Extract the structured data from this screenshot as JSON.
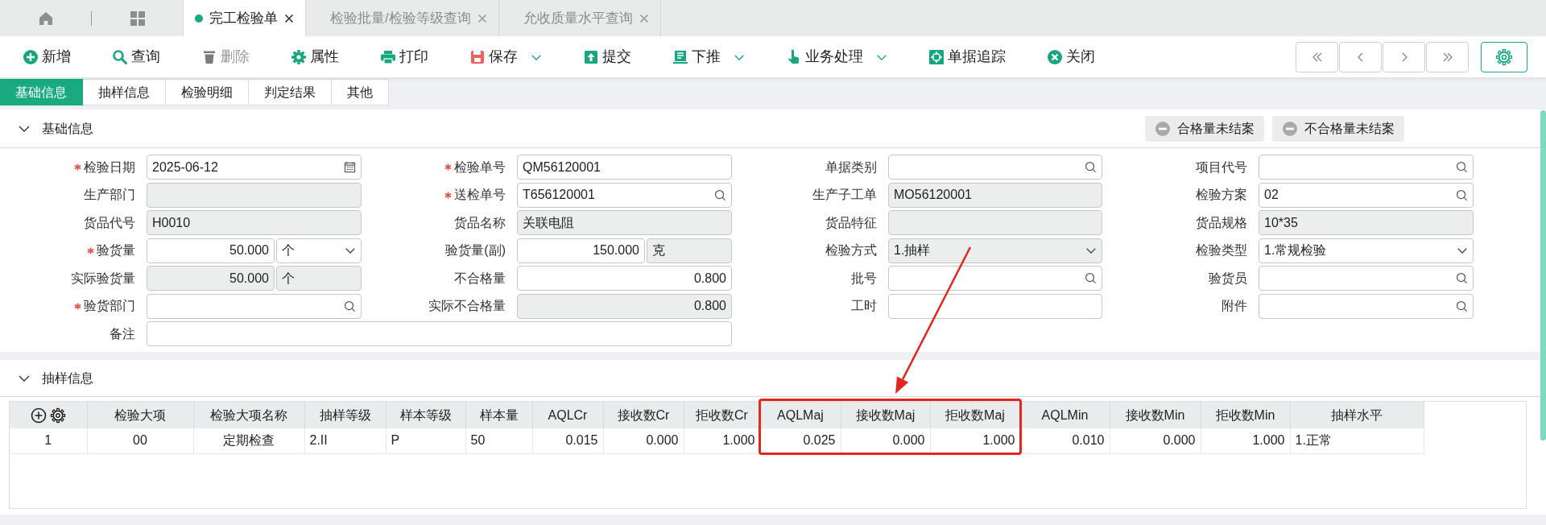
{
  "tabs": [
    {
      "label": "完工检验单",
      "selected": true
    },
    {
      "label": "检验批量/检验等级查询",
      "selected": false
    },
    {
      "label": "允收质量水平查询",
      "selected": false
    }
  ],
  "toolbar": [
    {
      "label": "新增",
      "disabled": false,
      "dropdown": false
    },
    {
      "label": "查询",
      "disabled": false,
      "dropdown": false
    },
    {
      "label": "删除",
      "disabled": true,
      "dropdown": false
    },
    {
      "label": "属性",
      "disabled": false,
      "dropdown": false
    },
    {
      "label": "打印",
      "disabled": false,
      "dropdown": false
    },
    {
      "label": "保存",
      "disabled": false,
      "dropdown": true
    },
    {
      "label": "提交",
      "disabled": false,
      "dropdown": false
    },
    {
      "label": "下推",
      "disabled": false,
      "dropdown": true
    },
    {
      "label": "业务处理",
      "disabled": false,
      "dropdown": true
    },
    {
      "label": "单据追踪",
      "disabled": false,
      "dropdown": false
    },
    {
      "label": "关闭",
      "disabled": false,
      "dropdown": false
    }
  ],
  "subtabs": [
    {
      "label": "基础信息",
      "selected": true
    },
    {
      "label": "抽样信息",
      "selected": false
    },
    {
      "label": "检验明细",
      "selected": false
    },
    {
      "label": "判定结果",
      "selected": false
    },
    {
      "label": "其他",
      "selected": false
    }
  ],
  "basic_section": {
    "title": "基础信息",
    "expanded": true,
    "actions": [
      "合格量未结案",
      "不合格量未结案"
    ],
    "rows": [
      [
        {
          "label": "检验日期",
          "required": true,
          "kind": "date",
          "readonly": false,
          "value": "2025-06-12"
        },
        {
          "label": "检验单号",
          "required": true,
          "kind": "text",
          "readonly": false,
          "value": "QM56120001"
        },
        {
          "label": "单据类别",
          "required": false,
          "kind": "lookup",
          "readonly": false
        },
        {
          "label": "项目代号",
          "required": false,
          "kind": "lookup",
          "readonly": false
        }
      ],
      [
        {
          "label": "生产部门",
          "required": false,
          "kind": "text",
          "readonly": true
        },
        {
          "label": "送检单号",
          "required": true,
          "kind": "lookup",
          "readonly": false,
          "value": "T656120001"
        },
        {
          "label": "生产子工单",
          "required": false,
          "kind": "text",
          "readonly": true,
          "value": "MO56120001"
        },
        {
          "label": "检验方案",
          "required": false,
          "kind": "lookup",
          "readonly": false,
          "value": "02"
        }
      ],
      [
        {
          "label": "货品代号",
          "required": false,
          "kind": "text",
          "readonly": true,
          "value": "H0010"
        },
        {
          "label": "货品名称",
          "required": false,
          "kind": "text",
          "readonly": true,
          "value": "关联电阻"
        },
        {
          "label": "货品特征",
          "required": false,
          "kind": "text",
          "readonly": true
        },
        {
          "label": "货品规格",
          "required": false,
          "kind": "text",
          "readonly": true,
          "value": "10*35"
        }
      ],
      [
        {
          "label": "验货量",
          "required": true,
          "kind": "quantity",
          "readonly": false,
          "value": "50.000",
          "unit": {
            "value": "个",
            "readonly": false,
            "dropdown": true
          }
        },
        {
          "label": "验货量(副)",
          "required": false,
          "kind": "quantity",
          "readonly": false,
          "value": "150.000",
          "unit": {
            "value": "克",
            "readonly": true,
            "dropdown": false
          }
        },
        {
          "label": "检验方式",
          "required": false,
          "kind": "select",
          "readonly": true,
          "value": "1.抽样"
        },
        {
          "label": "检验类型",
          "required": false,
          "kind": "select",
          "readonly": false,
          "value": "1.常规检验"
        }
      ],
      [
        {
          "label": "实际验货量",
          "required": false,
          "kind": "quantity",
          "readonly": true,
          "value": "50.000",
          "unit": {
            "value": "个",
            "readonly": true,
            "dropdown": false
          }
        },
        {
          "label": "不合格量",
          "required": false,
          "kind": "number",
          "readonly": false,
          "value": "0.800"
        },
        {
          "label": "批号",
          "required": false,
          "kind": "lookup",
          "readonly": false
        },
        {
          "label": "验货员",
          "required": false,
          "kind": "lookup",
          "readonly": false
        }
      ],
      [
        {
          "label": "验货部门",
          "required": true,
          "kind": "lookup",
          "readonly": false
        },
        {
          "label": "实际不合格量",
          "required": false,
          "kind": "number",
          "readonly": true,
          "value": "0.800"
        },
        {
          "label": "工时",
          "required": false,
          "kind": "text",
          "readonly": false
        },
        {
          "label": "附件",
          "required": false,
          "kind": "lookup",
          "readonly": false
        }
      ],
      [
        {
          "label": "备注",
          "required": false,
          "kind": "text",
          "readonly": false,
          "wide": true
        }
      ]
    ]
  },
  "sampling_section": {
    "title": "抽样信息",
    "expanded": true,
    "table": {
      "columns": [
        {
          "label": "检验大项",
          "highlighted": false
        },
        {
          "label": "检验大项名称",
          "highlighted": false
        },
        {
          "label": "抽样等级",
          "highlighted": false
        },
        {
          "label": "样本等级",
          "highlighted": false
        },
        {
          "label": "样本量",
          "highlighted": false
        },
        {
          "label": "AQLCr",
          "highlighted": false
        },
        {
          "label": "接收数Cr",
          "highlighted": false
        },
        {
          "label": "拒收数Cr",
          "highlighted": false
        },
        {
          "label": "AQLMaj",
          "highlighted": true
        },
        {
          "label": "接收数Maj",
          "highlighted": true
        },
        {
          "label": "拒收数Maj",
          "highlighted": true
        },
        {
          "label": "AQLMin",
          "highlighted": false
        },
        {
          "label": "接收数Min",
          "highlighted": false
        },
        {
          "label": "拒收数Min",
          "highlighted": false
        },
        {
          "label": "抽样水平",
          "highlighted": false
        }
      ],
      "rows": [
        {
          "number": "1",
          "cells": [
            "00",
            "定期检查",
            "2.II",
            "P",
            "50",
            "0.015",
            "0.000",
            "1.000",
            "0.025",
            "0.000",
            "1.000",
            "0.010",
            "0.000",
            "1.000",
            "1.正常"
          ]
        }
      ]
    }
  }
}
